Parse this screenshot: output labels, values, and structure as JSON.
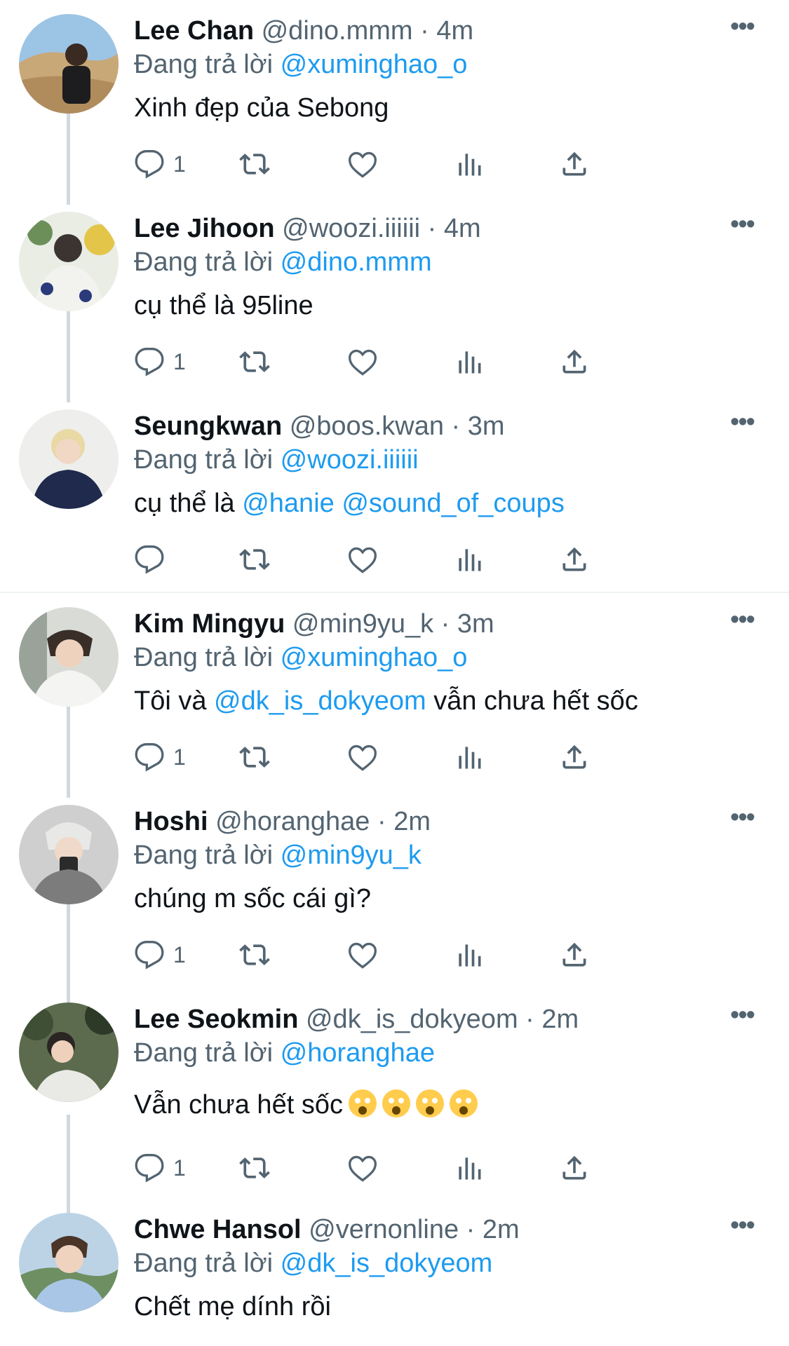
{
  "reply_prefix": "Đang trả lời",
  "colors": {
    "accent": "#1d9bf0",
    "muted": "#536471",
    "text": "#0f1419",
    "thread_line": "#cfd9de"
  },
  "icons": {
    "reply": "reply-icon",
    "retweet": "retweet-icon",
    "like": "heart-icon",
    "views": "views-icon",
    "share": "share-icon",
    "more": "more-icon"
  },
  "tweets": [
    {
      "name": "Lee Chan",
      "handle": "@dino.mmm",
      "sep": "·",
      "time": "4m",
      "reply_to": "@xuminghao_o",
      "text": "Xinh đẹp của Sebong",
      "reply_count": "1"
    },
    {
      "name": "Lee Jihoon",
      "handle": "@woozi.iiiiii",
      "sep": "·",
      "time": "4m",
      "reply_to": "@dino.mmm",
      "text": "cụ thể là 95line",
      "reply_count": "1"
    },
    {
      "name": "Seungkwan",
      "handle": "@boos.kwan",
      "sep": "·",
      "time": "3m",
      "reply_to": "@woozi.iiiiii",
      "text_pre": "cụ thể là ",
      "mention_1": "@hanie",
      "mention_2": "@sound_of_coups",
      "reply_count": ""
    },
    {
      "name": "Kim Mingyu",
      "handle": "@min9yu_k",
      "sep": "·",
      "time": "3m",
      "reply_to": "@xuminghao_o",
      "text_pre": "Tôi và ",
      "mention_1": "@dk_is_dokyeom",
      "text_post": " vẫn chưa hết sốc",
      "reply_count": "1"
    },
    {
      "name": "Hoshi",
      "handle": "@horanghae",
      "sep": "·",
      "time": "2m",
      "reply_to": "@min9yu_k",
      "text": "chúng m sốc cái gì?",
      "reply_count": "1"
    },
    {
      "name": "Lee Seokmin",
      "handle": "@dk_is_dokyeom",
      "sep": "·",
      "time": "2m",
      "reply_to": "@horanghae",
      "text": "Vẫn chưa hết sốc",
      "reply_count": "1"
    },
    {
      "name": "Chwe Hansol",
      "handle": "@vernonline",
      "sep": "·",
      "time": "2m",
      "reply_to": "@dk_is_dokyeom",
      "text": "Chết mẹ dính rồi"
    }
  ]
}
